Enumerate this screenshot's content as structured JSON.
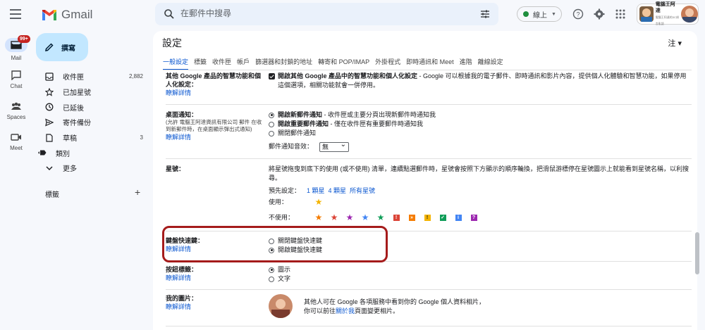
{
  "app": {
    "name": "Gmail"
  },
  "search": {
    "placeholder": "在郵件中搜尋"
  },
  "status": {
    "label": "線上"
  },
  "account": {
    "brand": "電腦王阿達",
    "brand_sub": "電腦王阿達的3C胡言亂語"
  },
  "rail": {
    "mail_label": "Mail",
    "mail_badge": "99+",
    "chat_label": "Chat",
    "spaces_label": "Spaces",
    "meet_label": "Meet"
  },
  "compose": {
    "label": "撰寫"
  },
  "nav": {
    "items": [
      {
        "label": "收件匣",
        "count": "2,882",
        "icon": "inbox-icon"
      },
      {
        "label": "已加星號",
        "count": "",
        "icon": "star-icon"
      },
      {
        "label": "已延後",
        "count": "",
        "icon": "clock-icon"
      },
      {
        "label": "寄件備份",
        "count": "",
        "icon": "send-icon"
      },
      {
        "label": "草稿",
        "count": "3",
        "icon": "draft-icon"
      },
      {
        "label": "類別",
        "count": "",
        "icon": "label-icon"
      },
      {
        "label": "更多",
        "count": "",
        "icon": "chevron-down-icon"
      }
    ],
    "labels_header": "標籤"
  },
  "settings": {
    "title": "設定",
    "lang": "注",
    "tabs": [
      "一般設定",
      "標籤",
      "收件匣",
      "帳戶",
      "篩選器和封鎖的地址",
      "轉寄和 POP/IMAP",
      "外掛程式",
      "即時通訊和 Meet",
      "進階",
      "離線設定"
    ],
    "learn_more": "瞭解詳情",
    "smart": {
      "label": "其他 Google 產品的智慧功能和個人化設定：",
      "desc_bold": "開啟其他 Google 產品中的智慧功能和個人化設定",
      "desc": " - Google 可以根據我的電子郵件、即時通訊和影片內容，提供個人化體驗和智慧功能，如果停用這個選項，相關功能就會一併停用。"
    },
    "desktop": {
      "label": "桌面通知：",
      "sub": "(允許 電腦王阿達資訊有限公司 郵件 在收到新郵件時，在桌面顯示彈出式通知)",
      "opt1_bold": "開啟新郵件通知",
      "opt1": " - 收件匣或主要分頁出現新郵件時通知我",
      "opt2_bold": "開啟重要郵件通知",
      "opt2": " - 僅在收件匣有重要郵件時通知我",
      "opt3": "關閉郵件通知",
      "sound_label": "郵件通知音效：",
      "sound_value": "無"
    },
    "stars": {
      "label": "星號：",
      "desc": "將星號拖曳到底下的使用 (或不使用) 清單，連續點選郵件時，星號會按照下方顯示的順序輪換，把滑鼠游標停在星號圖示上就能看到星號名稱，以利搜尋。",
      "presets_label": "預先設定：",
      "preset1": "1 顆星",
      "preset4": "4 顆星",
      "preset_all": "所有星號",
      "used_label": "使用：",
      "unused_label": "不使用："
    },
    "shortcuts": {
      "label": "鍵盤快速鍵：",
      "off": "關閉鍵盤快速鍵",
      "on": "開啟鍵盤快速鍵"
    },
    "buttons": {
      "label": "按鈕標籤：",
      "icon": "圖示",
      "text": "文字"
    },
    "photo": {
      "label": "我的圖片：",
      "line1": "其他人可在 Google 各項服務中看到你的 Google 個人資料相片，",
      "line2_pre": "你可以前往",
      "line2_link": "關於我",
      "line2_post": "頁面變更相片。"
    }
  }
}
